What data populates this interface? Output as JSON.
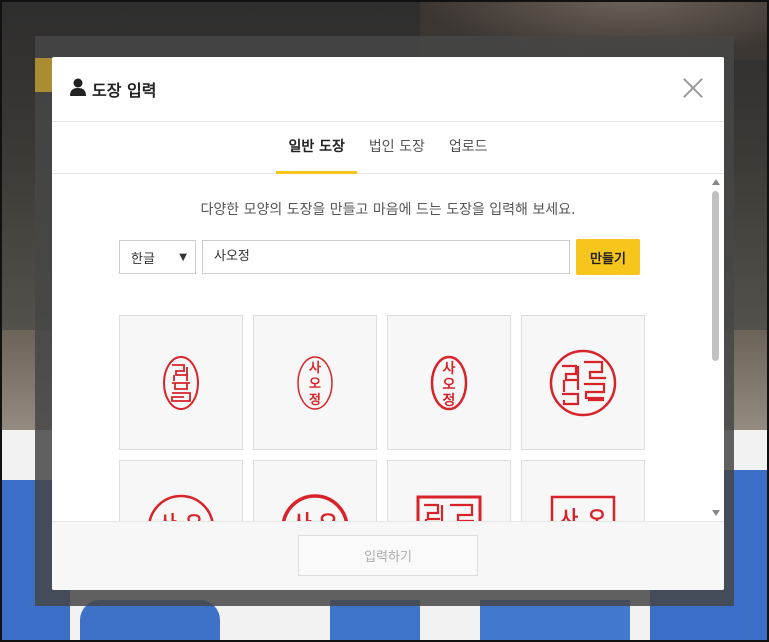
{
  "dialog": {
    "title": "도장 입력",
    "title_icon": "user-icon"
  },
  "tabs": [
    {
      "label": "일반 도장",
      "active": true
    },
    {
      "label": "법인 도장",
      "active": false
    },
    {
      "label": "업로드",
      "active": false
    }
  ],
  "description": "다양한 모양의 도장을 만들고 마음에 드는 도장을 입력해 보세요.",
  "form": {
    "language": "한글",
    "name_value": "사오정",
    "make_label": "만들기"
  },
  "stamps": {
    "text": "사오정",
    "chars": [
      "사",
      "오",
      "정"
    ],
    "color": "#d8232a",
    "styles": [
      "oval-seal-script",
      "oval-plain",
      "oval-bold",
      "circle-seal-script",
      "circle-plain",
      "circle-bold",
      "square-seal-script",
      "square-plain"
    ]
  },
  "footer": {
    "submit_label": "입력하기"
  },
  "colors": {
    "accent": "#f7c61c",
    "stamp_red": "#d8232a"
  }
}
